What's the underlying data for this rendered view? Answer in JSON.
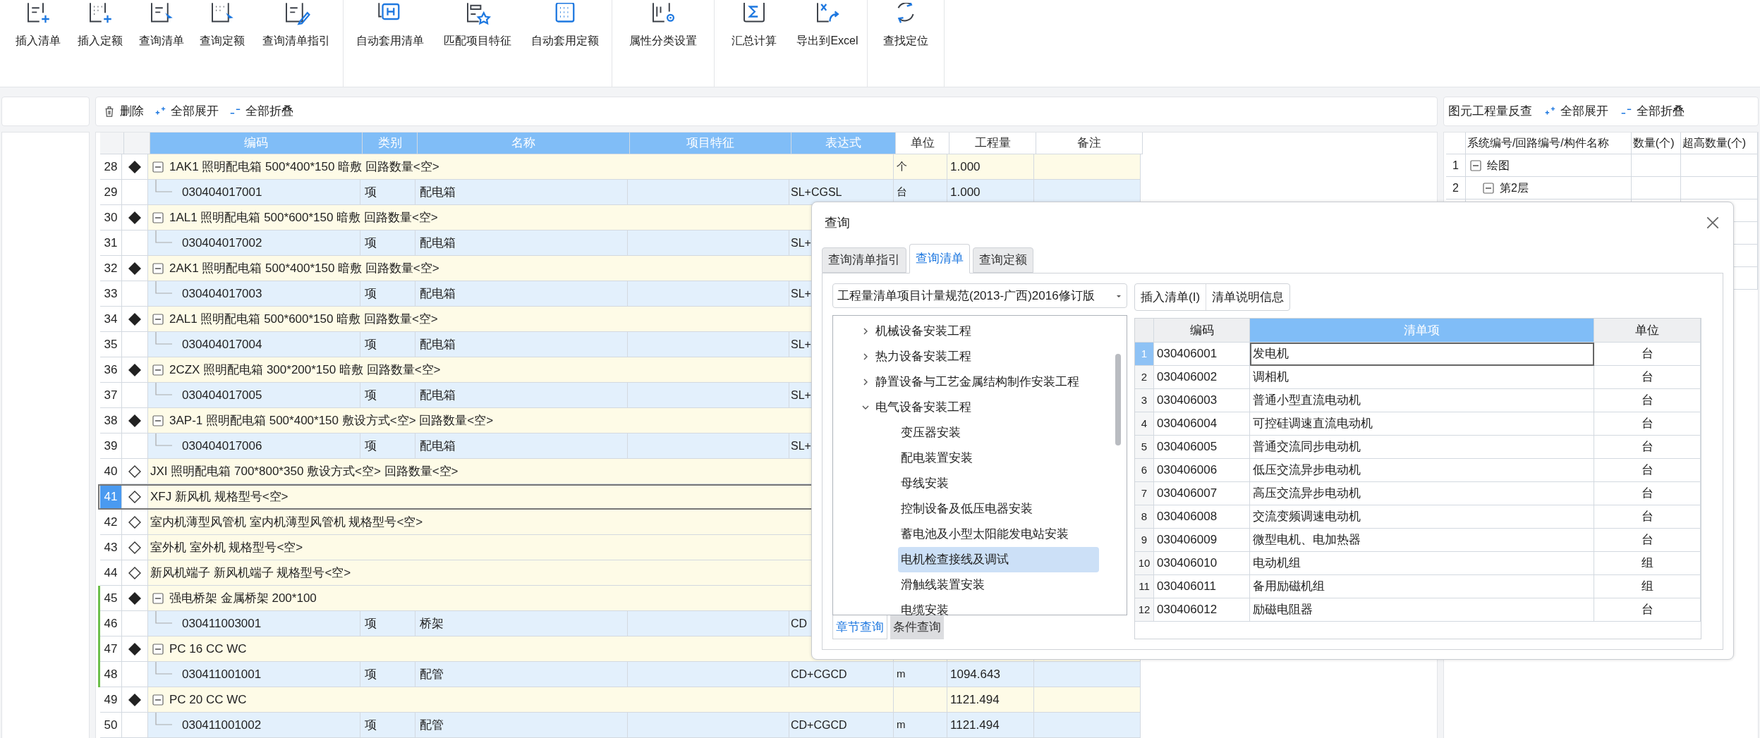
{
  "toolbar": {
    "groups": [
      {
        "buttons": [
          "插入清单",
          "插入定额",
          "查询清单",
          "查询定额",
          "查询清单指引"
        ]
      },
      {
        "buttons": [
          "自动套用清单",
          "匹配项目特征",
          "自动套用定额"
        ]
      },
      {
        "buttons": [
          "属性分类设置"
        ]
      },
      {
        "buttons": [
          "汇总计算",
          "导出到Excel"
        ]
      },
      {
        "buttons": [
          "查找定位"
        ]
      }
    ]
  },
  "list_toolbar": {
    "buttons": [
      "删除",
      "全部展开",
      "全部折叠"
    ]
  },
  "table": {
    "columns": [
      {
        "label": "编码",
        "highlighted": true
      },
      {
        "label": "类别",
        "highlighted": true
      },
      {
        "label": "名称",
        "highlighted": true
      },
      {
        "label": "项目特征",
        "highlighted": true
      },
      {
        "label": "表达式",
        "highlighted": true
      },
      {
        "label": "单位",
        "highlighted": false
      },
      {
        "label": "工程量",
        "highlighted": false
      },
      {
        "label": "备注",
        "highlighted": false
      }
    ],
    "rows": [
      {
        "num": "28",
        "kind": "group",
        "expanded": true,
        "selected": false,
        "marked": false,
        "text": "1AK1 照明配电箱 500*400*150 暗敷 回路数量<空>",
        "unit": "个",
        "quantity": "1.000"
      },
      {
        "num": "29",
        "kind": "item",
        "selected": false,
        "marked": false,
        "code": "030404017001",
        "type": "项",
        "name": "配电箱",
        "expression": "SL+CGSL",
        "unit": "台",
        "quantity": "1.000"
      },
      {
        "num": "30",
        "kind": "group",
        "expanded": true,
        "selected": false,
        "marked": false,
        "text": "1AL1 照明配电箱 500*600*150 暗敷 回路数量<空>"
      },
      {
        "num": "31",
        "kind": "item",
        "selected": false,
        "marked": false,
        "code": "030404017002",
        "type": "项",
        "name": "配电箱",
        "expression": "SL+"
      },
      {
        "num": "32",
        "kind": "group",
        "expanded": true,
        "selected": false,
        "marked": false,
        "text": "2AK1 照明配电箱 500*400*150 暗敷 回路数量<空>"
      },
      {
        "num": "33",
        "kind": "item",
        "selected": false,
        "marked": false,
        "code": "030404017003",
        "type": "项",
        "name": "配电箱",
        "expression": "SL+"
      },
      {
        "num": "34",
        "kind": "group",
        "expanded": true,
        "selected": false,
        "marked": false,
        "text": "2AL1 照明配电箱 500*600*150 暗敷 回路数量<空>"
      },
      {
        "num": "35",
        "kind": "item",
        "selected": false,
        "marked": false,
        "code": "030404017004",
        "type": "项",
        "name": "配电箱",
        "expression": "SL+"
      },
      {
        "num": "36",
        "kind": "group",
        "expanded": true,
        "selected": false,
        "marked": false,
        "text": "2CZX 照明配电箱 300*200*150 暗敷 回路数量<空>"
      },
      {
        "num": "37",
        "kind": "item",
        "selected": false,
        "marked": false,
        "code": "030404017005",
        "type": "项",
        "name": "配电箱",
        "expression": "SL+"
      },
      {
        "num": "38",
        "kind": "group",
        "expanded": true,
        "selected": false,
        "marked": false,
        "text": "3AP-1 照明配电箱 500*400*150 敷设方式<空> 回路数量<空>"
      },
      {
        "num": "39",
        "kind": "item",
        "selected": false,
        "marked": false,
        "code": "030404017006",
        "type": "项",
        "name": "配电箱",
        "expression": "SL+"
      },
      {
        "num": "40",
        "kind": "entry",
        "selected": false,
        "marked": false,
        "text": "JXI 照明配电箱 700*800*350 敷设方式<空> 回路数量<空>"
      },
      {
        "num": "41",
        "kind": "entry",
        "selected": true,
        "marked": false,
        "text": "XFJ 新风机 规格型号<空>"
      },
      {
        "num": "42",
        "kind": "entry",
        "selected": false,
        "marked": false,
        "text": "室内机薄型风管机 室内机薄型风管机 规格型号<空>"
      },
      {
        "num": "43",
        "kind": "entry",
        "selected": false,
        "marked": false,
        "text": "室外机 室外机 规格型号<空>"
      },
      {
        "num": "44",
        "kind": "entry",
        "selected": false,
        "marked": false,
        "text": "新风机端子 新风机端子 规格型号<空>"
      },
      {
        "num": "45",
        "kind": "group",
        "expanded": true,
        "selected": false,
        "marked": true,
        "text": "强电桥架 金属桥架 200*100"
      },
      {
        "num": "46",
        "kind": "item",
        "selected": false,
        "marked": true,
        "code": "030411003001",
        "type": "项",
        "name": "桥架",
        "expression": "CD"
      },
      {
        "num": "47",
        "kind": "group",
        "expanded": true,
        "selected": false,
        "marked": true,
        "text": "PC 16 CC WC"
      },
      {
        "num": "48",
        "kind": "item",
        "selected": false,
        "marked": true,
        "code": "030411001001",
        "type": "项",
        "name": "配管",
        "expression": "CD+CGCD",
        "unit": "m",
        "quantity": "1094.643"
      },
      {
        "num": "49",
        "kind": "group",
        "expanded": true,
        "selected": false,
        "marked": false,
        "text": "PC 20 CC WC",
        "quantity": "1121.494"
      },
      {
        "num": "50",
        "kind": "item",
        "selected": false,
        "marked": false,
        "code": "030411001002",
        "type": "项",
        "name": "配管",
        "expression": "CD+CGCD",
        "unit": "m",
        "quantity": "1121.494"
      }
    ]
  },
  "reverse_panel": {
    "title": "图元工程量反查",
    "buttons": [
      "全部展开",
      "全部折叠"
    ],
    "columns": [
      "系统编号/回路编号/构件名称",
      "数量(个)",
      "超高数量(个)"
    ],
    "rows": [
      {
        "num": "1",
        "label": "绘图",
        "expanded": true,
        "children": [
          {
            "num": "2",
            "label": "第2层",
            "expanded": true
          }
        ]
      }
    ]
  },
  "dialog": {
    "title": "查询",
    "tabs": [
      {
        "label": "查询清单指引",
        "selected": false
      },
      {
        "label": "查询清单",
        "selected": true
      },
      {
        "label": "查询定额",
        "selected": false
      }
    ],
    "standard": "工程量清单项目计量规范(2013-广西)2016修订版",
    "buttons": [
      "插入清单(I)",
      "清单说明信息"
    ],
    "tree": [
      {
        "label": "机械设备安装工程",
        "expanded": false,
        "selected": false
      },
      {
        "label": "热力设备安装工程",
        "expanded": false,
        "selected": false
      },
      {
        "label": "静置设备与工艺金属结构制作安装工程",
        "expanded": false,
        "selected": false
      },
      {
        "label": "电气设备安装工程",
        "expanded": true,
        "selected": false,
        "children": [
          {
            "label": "变压器安装",
            "selected": false
          },
          {
            "label": "配电装置安装",
            "selected": false
          },
          {
            "label": "母线安装",
            "selected": false
          },
          {
            "label": "控制设备及低压电器安装",
            "selected": false
          },
          {
            "label": "蓄电池及小型太阳能发电站安装",
            "selected": false
          },
          {
            "label": "电机检查接线及调试",
            "selected": true
          },
          {
            "label": "滑触线装置安装",
            "selected": false
          },
          {
            "label": "电缆安装",
            "selected": false
          }
        ]
      }
    ],
    "bottom_tabs": [
      {
        "label": "章节查询",
        "selected": true
      },
      {
        "label": "条件查询",
        "selected": false
      }
    ],
    "grid": {
      "columns": [
        {
          "label": "编码",
          "highlighted": false
        },
        {
          "label": "清单项",
          "highlighted": true
        },
        {
          "label": "单位",
          "highlighted": false
        }
      ],
      "rows": [
        {
          "num": "1",
          "code": "030406001",
          "name": "发电机",
          "unit": "台",
          "selected": true
        },
        {
          "num": "2",
          "code": "030406002",
          "name": "调相机",
          "unit": "台",
          "selected": false
        },
        {
          "num": "3",
          "code": "030406003",
          "name": "普通小型直流电动机",
          "unit": "台",
          "selected": false
        },
        {
          "num": "4",
          "code": "030406004",
          "name": "可控硅调速直流电动机",
          "unit": "台",
          "selected": false
        },
        {
          "num": "5",
          "code": "030406005",
          "name": "普通交流同步电动机",
          "unit": "台",
          "selected": false
        },
        {
          "num": "6",
          "code": "030406006",
          "name": "低压交流异步电动机",
          "unit": "台",
          "selected": false
        },
        {
          "num": "7",
          "code": "030406007",
          "name": "高压交流异步电动机",
          "unit": "台",
          "selected": false
        },
        {
          "num": "8",
          "code": "030406008",
          "name": "交流变频调速电动机",
          "unit": "台",
          "selected": false
        },
        {
          "num": "9",
          "code": "030406009",
          "name": "微型电机、电加热器",
          "unit": "台",
          "selected": false
        },
        {
          "num": "10",
          "code": "030406010",
          "name": "电动机组",
          "unit": "组",
          "selected": false
        },
        {
          "num": "11",
          "code": "030406011",
          "name": "备用励磁机组",
          "unit": "组",
          "selected": false
        },
        {
          "num": "12",
          "code": "030406012",
          "name": "励磁电阻器",
          "unit": "台",
          "selected": false
        }
      ]
    }
  }
}
